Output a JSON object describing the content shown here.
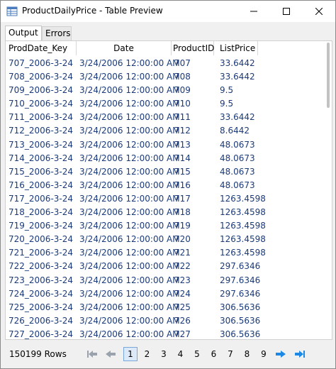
{
  "window": {
    "title": "ProductDailyPrice - Table Preview"
  },
  "tabs": [
    {
      "label": "Output"
    },
    {
      "label": "Errors"
    }
  ],
  "table": {
    "columns": [
      "ProdDate_Key",
      "Date",
      "ProductID",
      "ListPrice"
    ],
    "rows": [
      [
        "707_2006-3-24",
        "3/24/2006 12:00:00 AM",
        "707",
        "33.6442"
      ],
      [
        "708_2006-3-24",
        "3/24/2006 12:00:00 AM",
        "708",
        "33.6442"
      ],
      [
        "709_2006-3-24",
        "3/24/2006 12:00:00 AM",
        "709",
        "9.5"
      ],
      [
        "710_2006-3-24",
        "3/24/2006 12:00:00 AM",
        "710",
        "9.5"
      ],
      [
        "711_2006-3-24",
        "3/24/2006 12:00:00 AM",
        "711",
        "33.6442"
      ],
      [
        "712_2006-3-24",
        "3/24/2006 12:00:00 AM",
        "712",
        "8.6442"
      ],
      [
        "713_2006-3-24",
        "3/24/2006 12:00:00 AM",
        "713",
        "48.0673"
      ],
      [
        "714_2006-3-24",
        "3/24/2006 12:00:00 AM",
        "714",
        "48.0673"
      ],
      [
        "715_2006-3-24",
        "3/24/2006 12:00:00 AM",
        "715",
        "48.0673"
      ],
      [
        "716_2006-3-24",
        "3/24/2006 12:00:00 AM",
        "716",
        "48.0673"
      ],
      [
        "717_2006-3-24",
        "3/24/2006 12:00:00 AM",
        "717",
        "1263.4598"
      ],
      [
        "718_2006-3-24",
        "3/24/2006 12:00:00 AM",
        "718",
        "1263.4598"
      ],
      [
        "719_2006-3-24",
        "3/24/2006 12:00:00 AM",
        "719",
        "1263.4598"
      ],
      [
        "720_2006-3-24",
        "3/24/2006 12:00:00 AM",
        "720",
        "1263.4598"
      ],
      [
        "721_2006-3-24",
        "3/24/2006 12:00:00 AM",
        "721",
        "1263.4598"
      ],
      [
        "722_2006-3-24",
        "3/24/2006 12:00:00 AM",
        "722",
        "297.6346"
      ],
      [
        "723_2006-3-24",
        "3/24/2006 12:00:00 AM",
        "723",
        "297.6346"
      ],
      [
        "724_2006-3-24",
        "3/24/2006 12:00:00 AM",
        "724",
        "297.6346"
      ],
      [
        "725_2006-3-24",
        "3/24/2006 12:00:00 AM",
        "725",
        "306.5636"
      ],
      [
        "726_2006-3-24",
        "3/24/2006 12:00:00 AM",
        "726",
        "306.5636"
      ],
      [
        "727_2006-3-24",
        "3/24/2006 12:00:00 AM",
        "727",
        "306.5636"
      ]
    ]
  },
  "footer": {
    "row_count": "150199 Rows",
    "pages": [
      "1",
      "2",
      "3",
      "4",
      "5",
      "6",
      "7",
      "8",
      "9"
    ],
    "current_page": "1"
  },
  "colors": {
    "cell_text": "#1a3a7a",
    "nav_enabled": "#1e88e5",
    "nav_disabled": "#9aa3ad"
  },
  "icons": {
    "first": "first-page-icon",
    "prev": "prev-page-icon",
    "next": "next-page-icon",
    "last": "last-page-icon"
  }
}
